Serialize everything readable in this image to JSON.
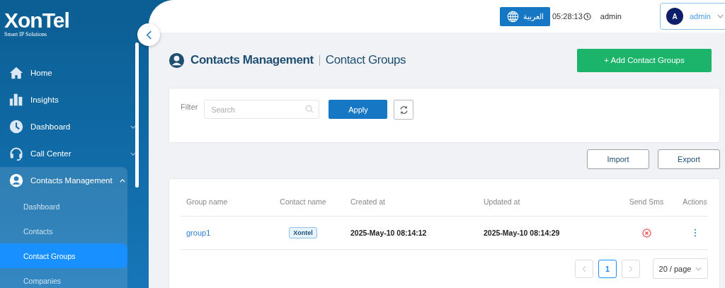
{
  "logo": {
    "name": "XonTel",
    "tagline": "Smart IP Solutions"
  },
  "sidebar": {
    "items": [
      {
        "label": "Home"
      },
      {
        "label": "Insights"
      },
      {
        "label": "Dashboard",
        "expanded": false
      },
      {
        "label": "Call Center",
        "expanded": false
      },
      {
        "label": "Contacts Management",
        "expanded": true,
        "children": [
          {
            "label": "Dashboard",
            "selected": false
          },
          {
            "label": "Contacts",
            "selected": false
          },
          {
            "label": "Contact Groups",
            "selected": true
          },
          {
            "label": "Companies",
            "selected": false
          }
        ]
      }
    ]
  },
  "header": {
    "language_button": "العربية",
    "time": "05:28:13",
    "username": "admin",
    "account": {
      "initial": "A",
      "name": "admin"
    }
  },
  "page": {
    "section": "Contacts Management",
    "title": "Contact Groups",
    "add_button": "+ Add Contact Groups"
  },
  "filter": {
    "label": "Filter",
    "search": {
      "placeholder": "Search"
    },
    "apply_button": "Apply"
  },
  "actions": [
    "Import",
    "Export"
  ],
  "table": {
    "columns": [
      "Group name",
      "Contact name",
      "Created at",
      "Updated at",
      "Send Sms",
      "Actions"
    ],
    "rows": [
      {
        "group_name": "group1",
        "contact_name": "Xontel",
        "created_at": "2025-May-10 08:14:12",
        "updated_at": "2025-May-10 08:14:29",
        "send_sms": false
      }
    ]
  },
  "pagination": {
    "pages": [
      {
        "label": "1",
        "selected": true
      }
    ],
    "page_size": "20 / page"
  }
}
